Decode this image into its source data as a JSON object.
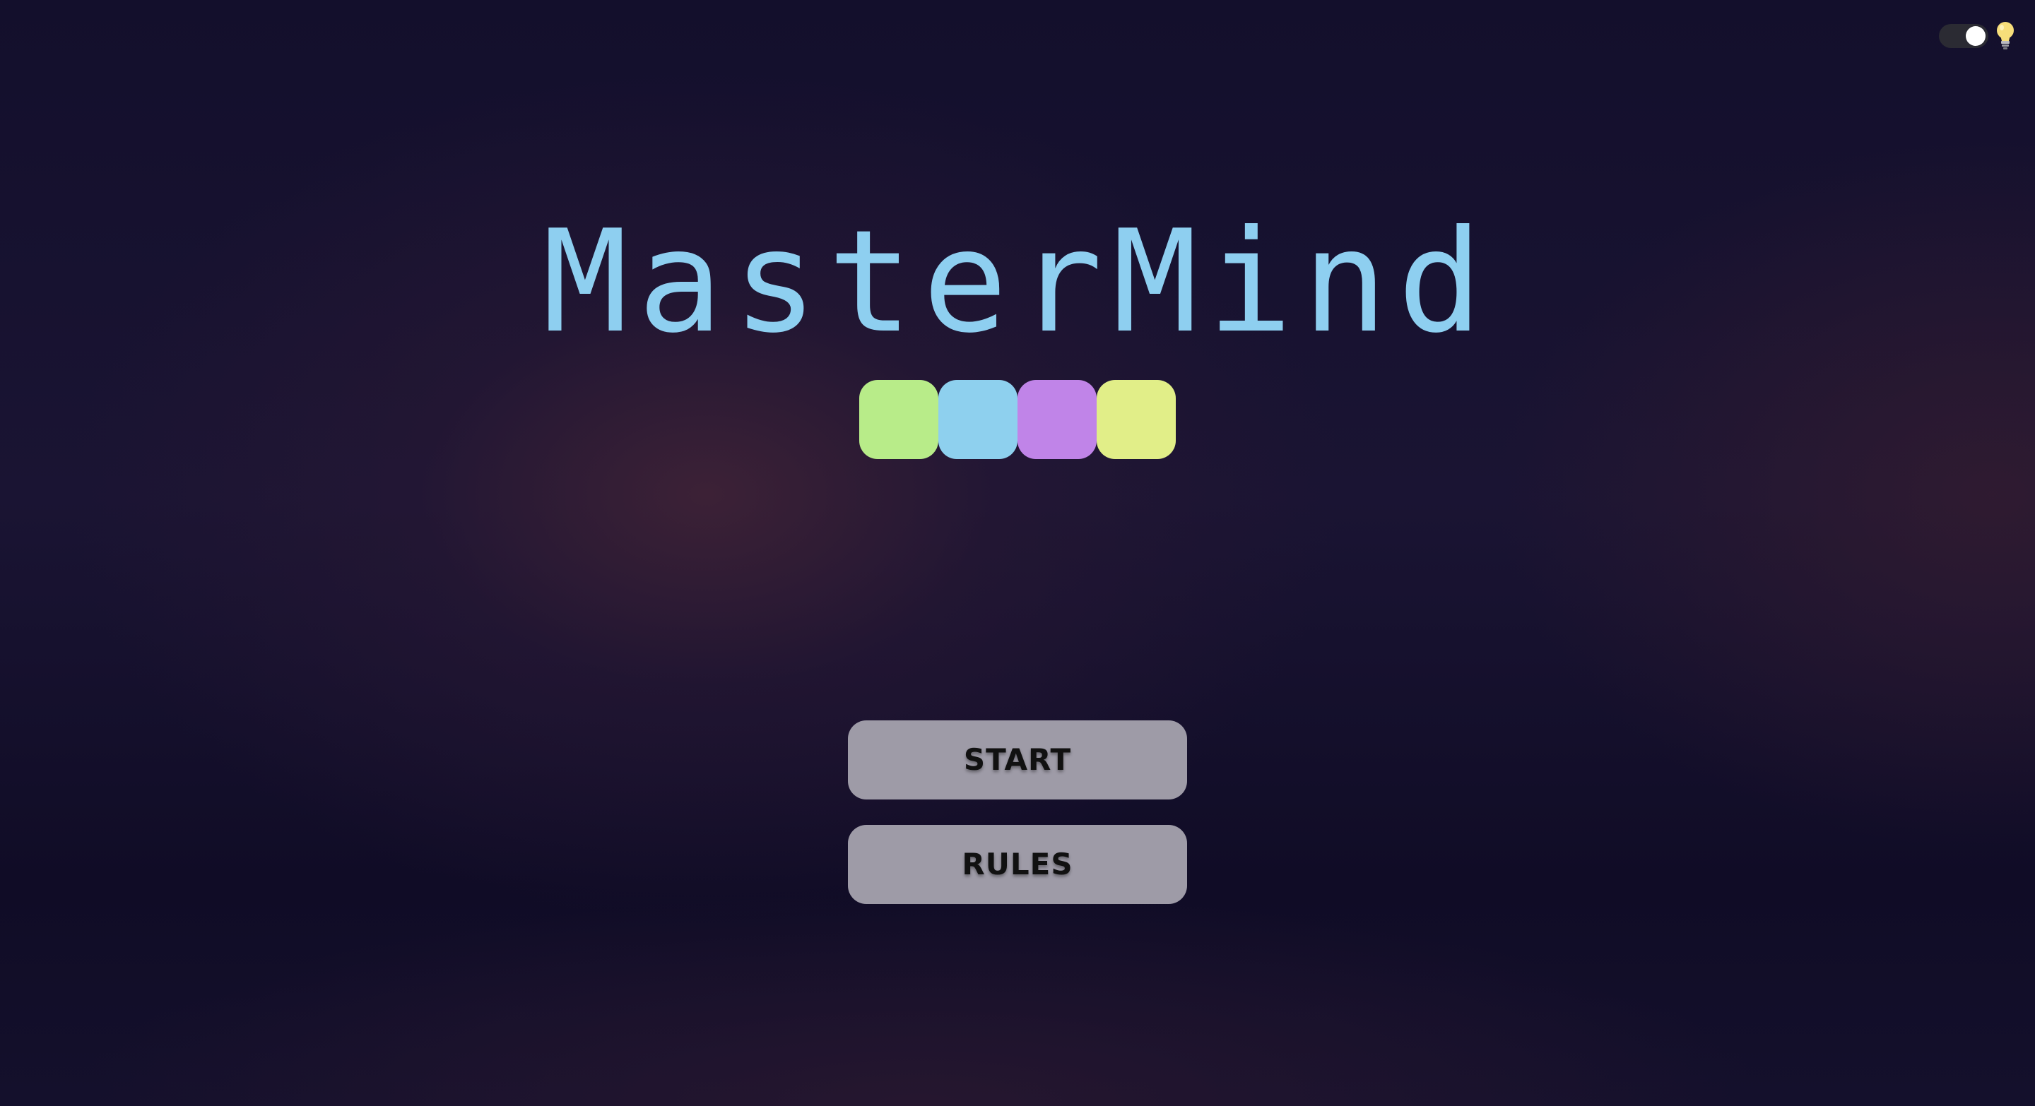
{
  "title": "MasterMind",
  "pegs": [
    {
      "color": "#b8ec89"
    },
    {
      "color": "#8ed0ee"
    },
    {
      "color": "#c084e8"
    },
    {
      "color": "#e1ee88"
    }
  ],
  "menu": {
    "start_label": "START",
    "rules_label": "RULES"
  },
  "theme_toggle": {
    "state": "on",
    "icon": "lightbulb-icon"
  },
  "colors": {
    "title": "#8ecff0",
    "button_bg": "#9e9ba7",
    "button_text": "#111111",
    "background": "#1a1433"
  }
}
